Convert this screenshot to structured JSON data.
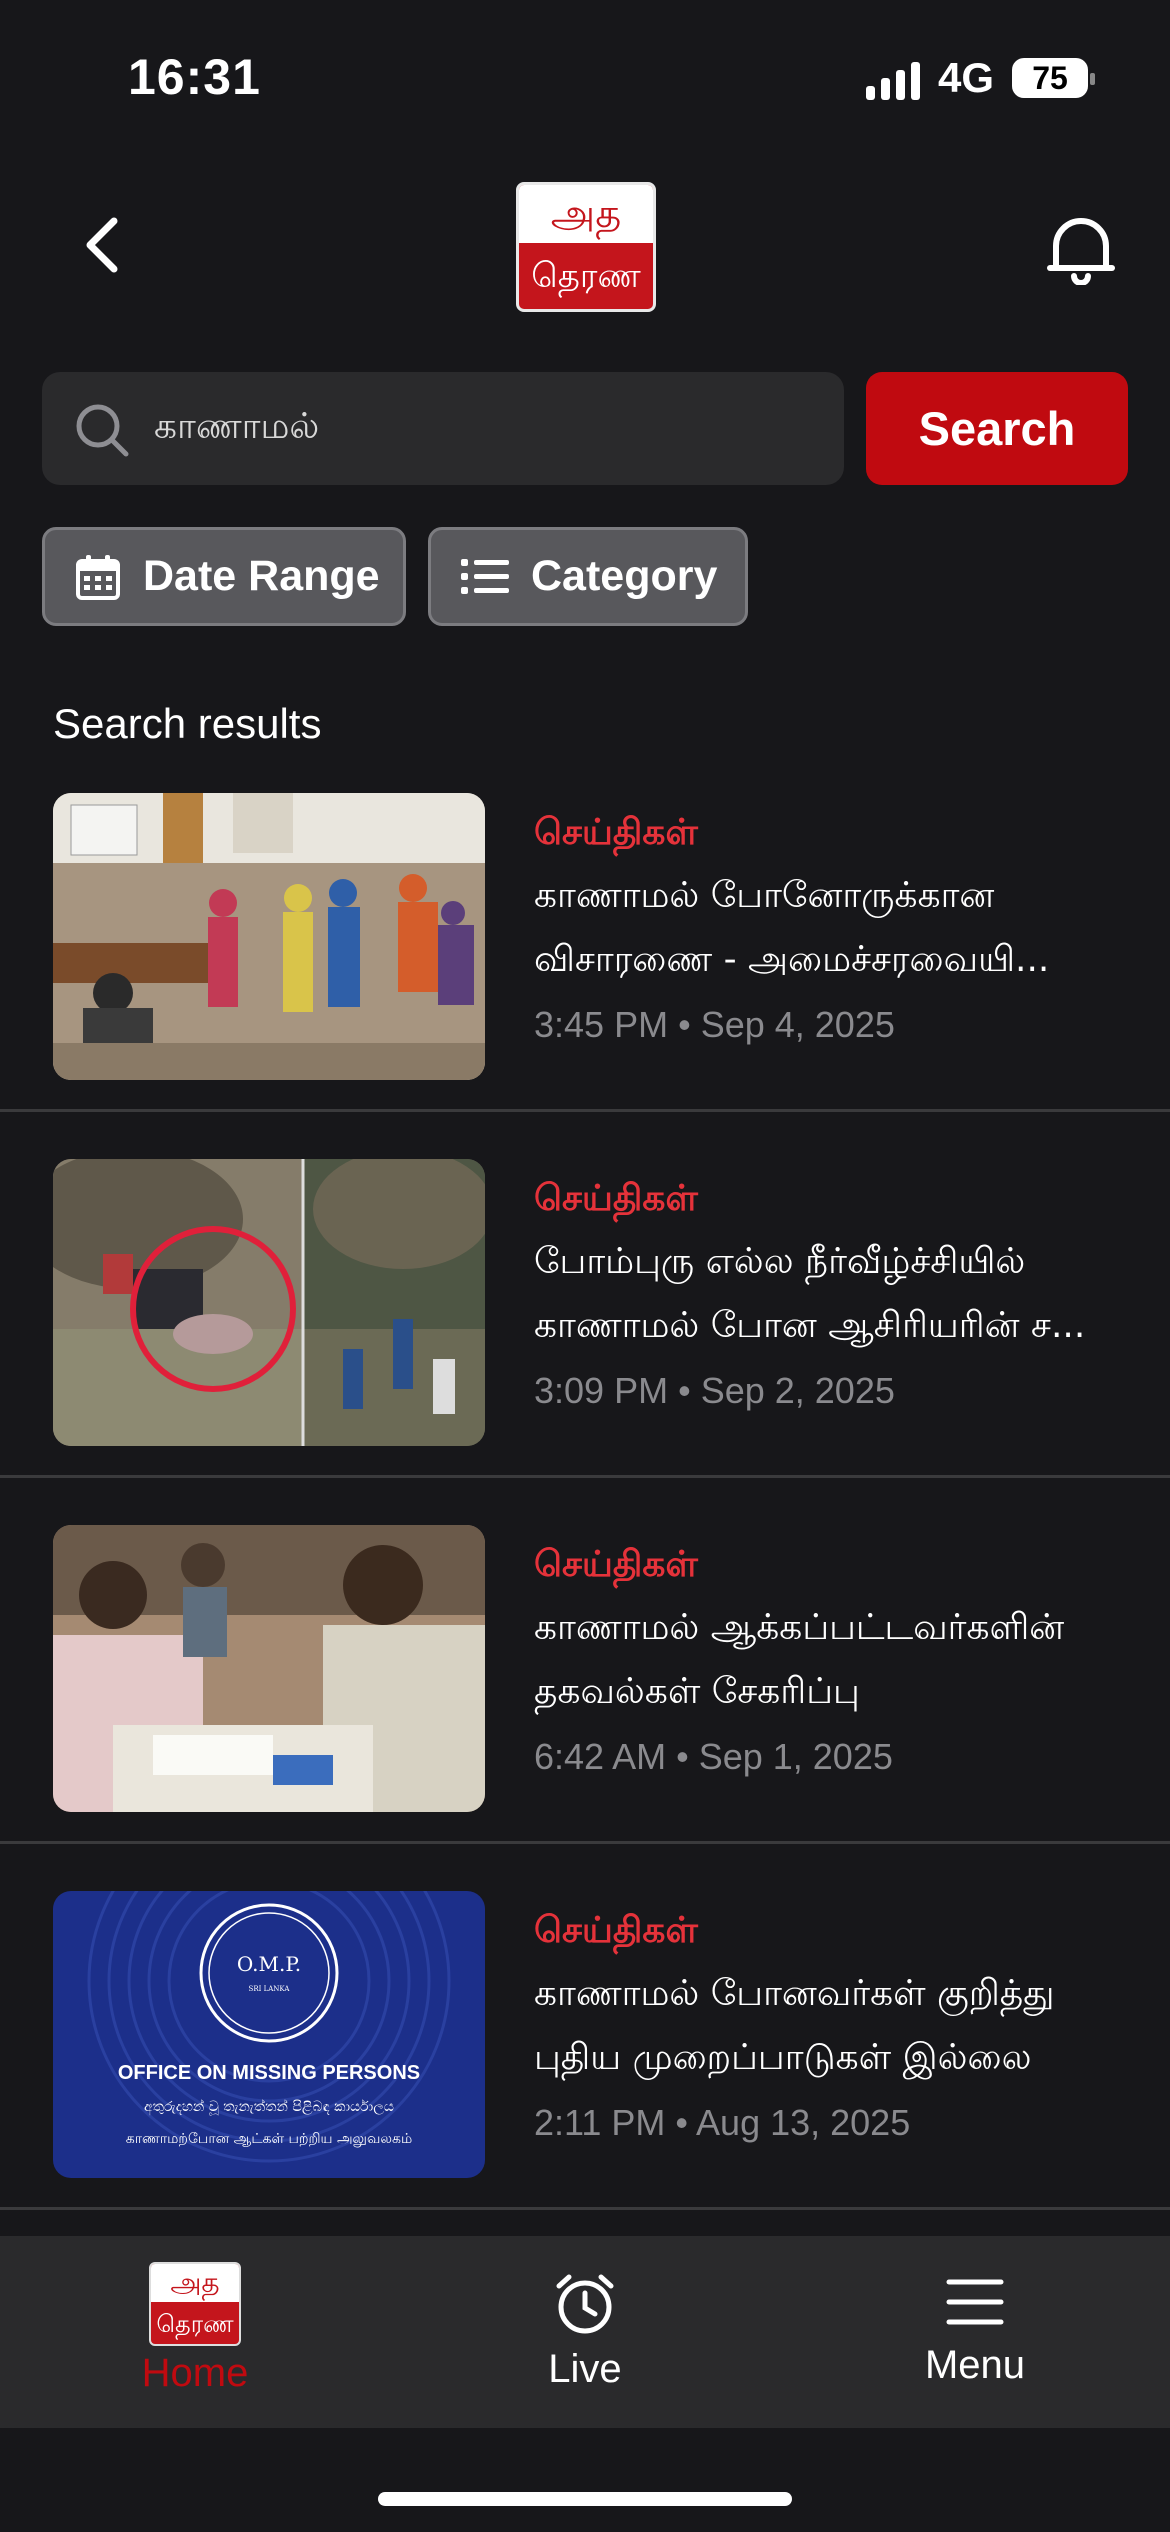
{
  "status": {
    "time": "16:31",
    "network": "4G",
    "battery": "75"
  },
  "header": {
    "logo_top": "அத",
    "logo_bottom": "தெரண"
  },
  "search": {
    "value": "காணாமல்",
    "button_label": "Search"
  },
  "filters": {
    "date_range": "Date Range",
    "category": "Category"
  },
  "results_title": "Search results",
  "results": [
    {
      "category": "செய்திகள்",
      "title_line1": "காணாமல் போனோருக்கான",
      "title_line2": "விசாரணை - அமைச்சரவையி...",
      "time": "3:45 PM",
      "date": "Sep 4, 2025",
      "thumb": "meeting-hall-photo"
    },
    {
      "category": "செய்திகள்",
      "title_line1": "போம்புரு எல்ல நீர்வீழ்ச்சியில்",
      "title_line2": "காணாமல் போன ஆசிரியரின் ச...",
      "time": "3:09 PM",
      "date": "Sep 2, 2025",
      "thumb": "waterfall-rescue-photo"
    },
    {
      "category": "செய்திகள்",
      "title_line1": "காணாமல் ஆக்கப்பட்டவர்களின்",
      "title_line2": "தகவல்கள் சேகரிப்பு",
      "time": "6:42 AM",
      "date": "Sep 1, 2025",
      "thumb": "documents-table-photo"
    },
    {
      "category": "செய்திகள்",
      "title_line1": "காணாமல் போனவர்கள் குறித்து",
      "title_line2": "புதிய முறைப்பாடுகள் இல்லை",
      "time": "2:11 PM",
      "date": "Aug 13, 2025",
      "thumb": "omp-banner"
    }
  ],
  "omp": {
    "abbr": "O.M.P.",
    "country": "SRI LANKA",
    "name": "OFFICE ON MISSING PERSONS",
    "sinhala": "අතුරුදහන් වූ තැනැත්තන් පිළිබඳ කාර්යාලය",
    "tamil": "காணாமற்போன ஆட்கள் பற்றிய அலுவலகம்"
  },
  "nav": {
    "home": "Home",
    "live": "Live",
    "menu": "Menu",
    "logo_top": "அத",
    "logo_bottom": "தெரண"
  },
  "colors": {
    "accent": "#c00a10",
    "category": "#e5323a",
    "background": "#17171a"
  }
}
